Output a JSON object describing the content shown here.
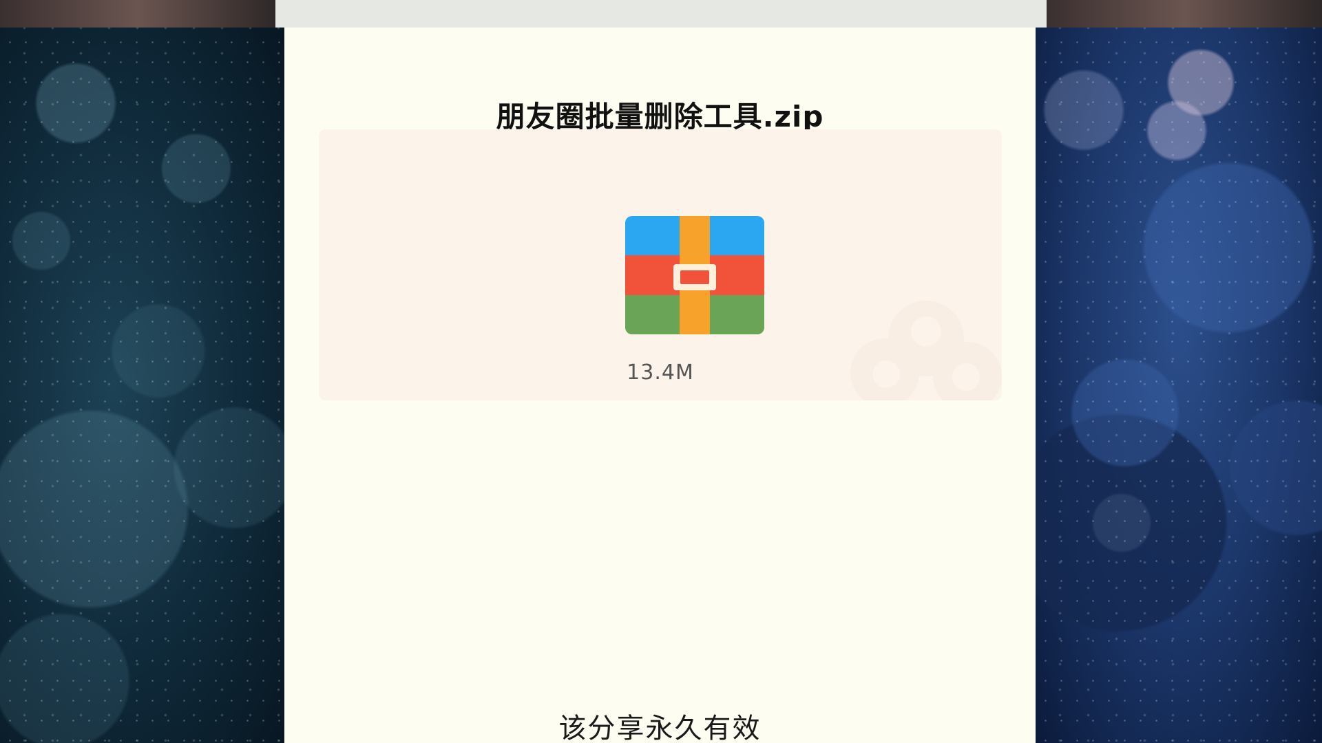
{
  "share": {
    "file_name": "朋友圈批量删除工具.zip",
    "file_size": "13.4M",
    "validity": "该分享永久有效",
    "file_icon": "zip-archive-icon"
  },
  "colors": {
    "panel_background": "#fefdf1",
    "card_background": "#fcf3ea",
    "icon_blue": "#2aa7f0",
    "icon_red": "#f0523a",
    "icon_green": "#6aa456",
    "icon_orange": "#f7a22a"
  }
}
